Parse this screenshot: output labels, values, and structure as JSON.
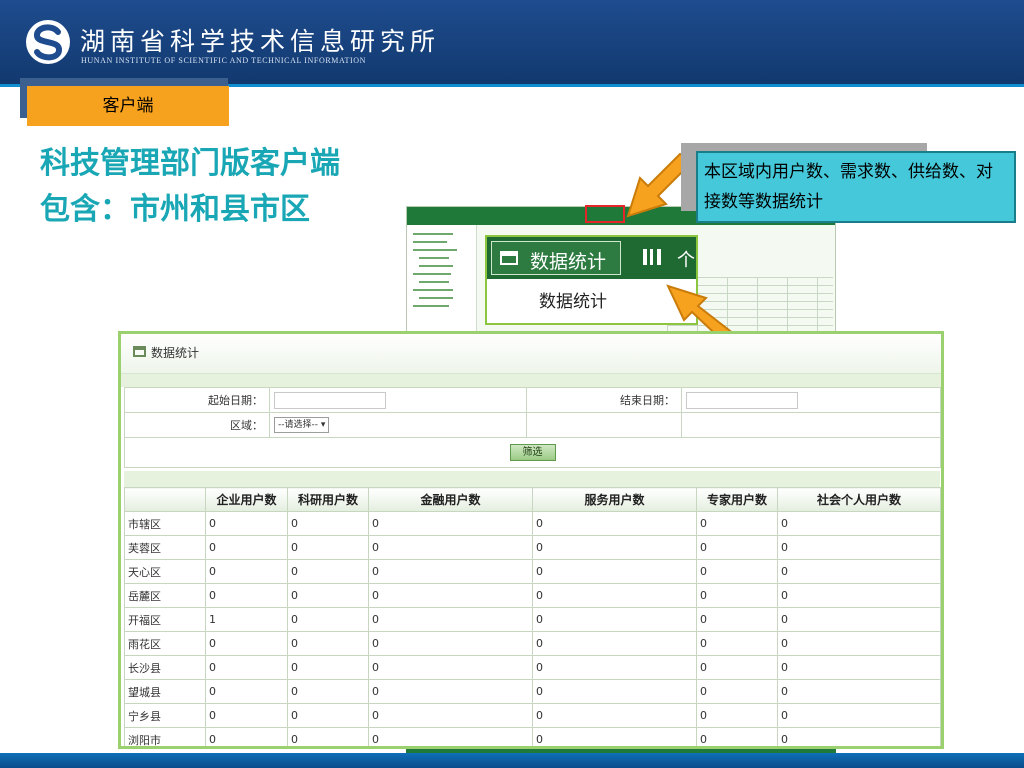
{
  "header": {
    "org_name_cn": "湖南省科学技术信息研究所",
    "org_name_en": "HUNAN INSTITUTE OF SCIENTIFIC AND TECHNICAL INFORMATION",
    "logo_icon": "swirl-s-logo-icon"
  },
  "section_tag": "客户端",
  "title_lines": [
    "科技管理部门版客户端",
    "包含：市州和县市区"
  ],
  "annotation": "本区域内用户数、需求数、供给数、对接数等数据统计",
  "zoom": {
    "tab_label": "数据统计",
    "tab_icon": "inbox-icon",
    "book_icon": "book-icon",
    "more_text": "个",
    "menu_item": "数据统计"
  },
  "panel": {
    "title": "数据统计",
    "title_icon": "home-icon",
    "filters": {
      "start_date_label": "起始日期：",
      "start_date_value": "",
      "end_date_label": "结束日期：",
      "end_date_value": "",
      "region_label": "区域：",
      "region_selected": "--请选择--",
      "filter_button": "筛选"
    },
    "columns": [
      "",
      "企业用户数",
      "科研用户数",
      "金融用户数",
      "服务用户数",
      "专家用户数",
      "社会个人用户数"
    ],
    "rows": [
      {
        "region": "市辖区",
        "cells": [
          "0",
          "0",
          "0",
          "0",
          "0",
          "0"
        ]
      },
      {
        "region": "芙蓉区",
        "cells": [
          "0",
          "0",
          "0",
          "0",
          "0",
          "0"
        ]
      },
      {
        "region": "天心区",
        "cells": [
          "0",
          "0",
          "0",
          "0",
          "0",
          "0"
        ]
      },
      {
        "region": "岳麓区",
        "cells": [
          "0",
          "0",
          "0",
          "0",
          "0",
          "0"
        ]
      },
      {
        "region": "开福区",
        "cells": [
          "1",
          "0",
          "0",
          "0",
          "0",
          "0"
        ]
      },
      {
        "region": "雨花区",
        "cells": [
          "0",
          "0",
          "0",
          "0",
          "0",
          "0"
        ]
      },
      {
        "region": "长沙县",
        "cells": [
          "0",
          "0",
          "0",
          "0",
          "0",
          "0"
        ]
      },
      {
        "region": "望城县",
        "cells": [
          "0",
          "0",
          "0",
          "0",
          "0",
          "0"
        ]
      },
      {
        "region": "宁乡县",
        "cells": [
          "0",
          "0",
          "0",
          "0",
          "0",
          "0"
        ]
      },
      {
        "region": "浏阳市",
        "cells": [
          "0",
          "0",
          "0",
          "0",
          "0",
          "0"
        ]
      }
    ]
  },
  "colors": {
    "header_bg": "#1e4c8e",
    "tag_bg": "#f7a21f",
    "title_text": "#1aa7b5",
    "annotation_bg": "#45c9da",
    "panel_border": "#9bd06e",
    "arrow": "#f7a21f",
    "highlight_red": "#e4262b"
  }
}
